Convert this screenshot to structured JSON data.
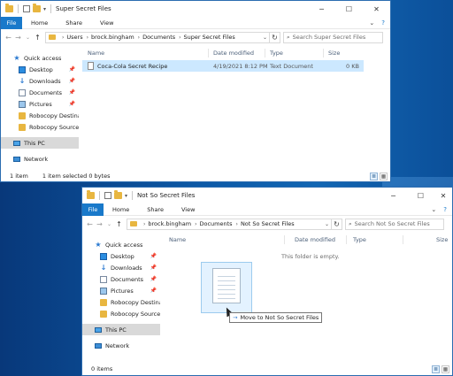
{
  "window1": {
    "title": "Super Secret Files",
    "ribbon_tabs": [
      "File",
      "Home",
      "Share",
      "View"
    ],
    "breadcrumbs": [
      "Users",
      "brock.bingham",
      "Documents",
      "Super Secret Files"
    ],
    "search_placeholder": "Search Super Secret Files",
    "nav_items": [
      {
        "label": "Quick access",
        "icon": "star-icon",
        "pinned": false
      },
      {
        "label": "Desktop",
        "icon": "desktop-icon",
        "pinned": true
      },
      {
        "label": "Downloads",
        "icon": "download-icon",
        "pinned": true
      },
      {
        "label": "Documents",
        "icon": "documents-icon",
        "pinned": true
      },
      {
        "label": "Pictures",
        "icon": "pictures-icon",
        "pinned": true
      },
      {
        "label": "Robocopy Destinati",
        "icon": "folder-icon",
        "pinned": false
      },
      {
        "label": "Robocopy Source",
        "icon": "folder-icon",
        "pinned": false
      },
      {
        "label": "This PC",
        "icon": "this-pc-icon",
        "pinned": false
      },
      {
        "label": "Network",
        "icon": "network-icon",
        "pinned": false
      }
    ],
    "columns": [
      "Name",
      "Date modified",
      "Type",
      "Size"
    ],
    "files": [
      {
        "name": "Coca-Cola Secret Recipe",
        "date": "4/19/2021 8:12 PM",
        "type": "Text Document",
        "size": "0 KB"
      }
    ],
    "status_count": "1 item",
    "status_selected": "1 item selected  0 bytes"
  },
  "window2": {
    "title": "Not So Secret Files",
    "ribbon_tabs": [
      "File",
      "Home",
      "Share",
      "View"
    ],
    "breadcrumbs": [
      "brock.bingham",
      "Documents",
      "Not So Secret Files"
    ],
    "search_placeholder": "Search Not So Secret Files",
    "nav_items": [
      {
        "label": "Quick access",
        "icon": "star-icon",
        "pinned": false
      },
      {
        "label": "Desktop",
        "icon": "desktop-icon",
        "pinned": true
      },
      {
        "label": "Downloads",
        "icon": "download-icon",
        "pinned": true
      },
      {
        "label": "Documents",
        "icon": "documents-icon",
        "pinned": true
      },
      {
        "label": "Pictures",
        "icon": "pictures-icon",
        "pinned": true
      },
      {
        "label": "Robocopy Destinati",
        "icon": "folder-icon",
        "pinned": false
      },
      {
        "label": "Robocopy Source",
        "icon": "folder-icon",
        "pinned": false
      },
      {
        "label": "This PC",
        "icon": "this-pc-icon",
        "pinned": false
      },
      {
        "label": "Network",
        "icon": "network-icon",
        "pinned": false
      }
    ],
    "columns": [
      "Name",
      "Date modified",
      "Type",
      "Size"
    ],
    "empty_text": "This folder is empty.",
    "status_count": "0 items",
    "drag_tooltip": "Move to Not So Secret Files"
  },
  "colors": {
    "accent": "#1979ca",
    "selection": "#cce8ff",
    "desktop": "#0a4a8f"
  }
}
